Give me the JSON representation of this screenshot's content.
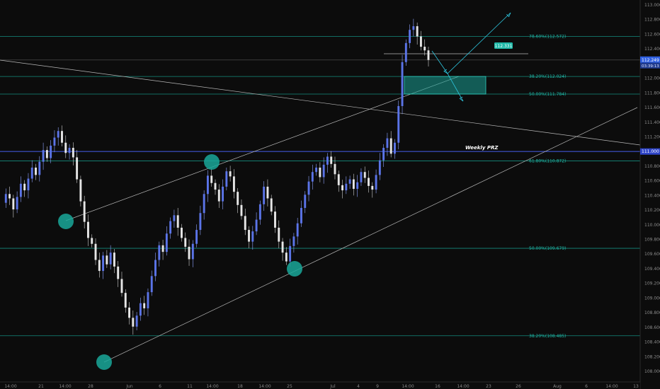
{
  "chart_data": {
    "type": "candlestick",
    "y_ticks": [
      "113.000",
      "112.800",
      "112.600",
      "112.400",
      "112.200",
      "112.000",
      "111.800",
      "111.600",
      "111.400",
      "111.200",
      "111.000",
      "110.800",
      "110.600",
      "110.400",
      "110.200",
      "110.000",
      "109.800",
      "109.600",
      "109.400",
      "109.200",
      "109.000",
      "108.800",
      "108.600",
      "108.400",
      "108.200",
      "108.000"
    ],
    "x_ticks": [
      "14:00",
      "21",
      "14:00",
      "28",
      "Jun",
      "6",
      "11",
      "14:00",
      "18",
      "14:00",
      "25",
      "Jul",
      "4",
      "9",
      "14:00",
      "16",
      "14:00",
      "23",
      "26",
      "Aug",
      "6",
      "14:00",
      "13"
    ],
    "fib_levels": [
      {
        "label": "78.60%(112.572)",
        "value": 112.572
      },
      {
        "label": "38.20%(112.024)",
        "value": 112.024
      },
      {
        "label": "50.00%(111.784)",
        "value": 111.784
      },
      {
        "label": "61.80%(110.872)",
        "value": 110.872
      },
      {
        "label": "50.00%(109.679)",
        "value": 109.679
      },
      {
        "label": "38.20%(108.485)",
        "value": 108.485
      }
    ],
    "annotations": {
      "weekly_prz": "Weekly PRZ",
      "current_price_tag": "112.331",
      "price_box_1": "112.249",
      "price_box_2": "03:39:13",
      "prz_price_tag": "111.000"
    },
    "series": [
      {
        "values": [
          110.3,
          110.42,
          110.36,
          110.21,
          110.38,
          110.56,
          110.47,
          110.63,
          110.78,
          110.68,
          110.86,
          111.02,
          110.91,
          111.08,
          111.19,
          111.28,
          111.12,
          110.98,
          111.05,
          110.92,
          110.62,
          110.32,
          110.04,
          109.82,
          109.74,
          109.52,
          109.37,
          109.58,
          109.46,
          109.62,
          109.43,
          109.26,
          109.07,
          108.87,
          108.73,
          108.61,
          108.76,
          108.93,
          108.86,
          109.08,
          109.3,
          109.52,
          109.72,
          109.63,
          109.88,
          110.05,
          110.13,
          109.96,
          109.82,
          109.7,
          109.53,
          109.74,
          109.93,
          110.16,
          110.42,
          110.67,
          110.57,
          110.48,
          110.32,
          110.52,
          110.73,
          110.66,
          110.45,
          110.27,
          110.12,
          109.93,
          109.77,
          109.91,
          110.07,
          110.28,
          110.52,
          110.36,
          110.18,
          109.96,
          109.77,
          109.62,
          109.5,
          109.71,
          109.84,
          110.02,
          110.23,
          110.41,
          110.59,
          110.72,
          110.78,
          110.65,
          110.82,
          110.93,
          110.83,
          110.69,
          110.54,
          110.47,
          110.56,
          110.62,
          110.49,
          110.58,
          110.72,
          110.64,
          110.53,
          110.48,
          110.68,
          110.88,
          111.05,
          111.18,
          110.97,
          111.12,
          111.62,
          112.22,
          112.48,
          112.66,
          112.71,
          112.57,
          112.43,
          112.38,
          112.25
        ]
      }
    ]
  }
}
